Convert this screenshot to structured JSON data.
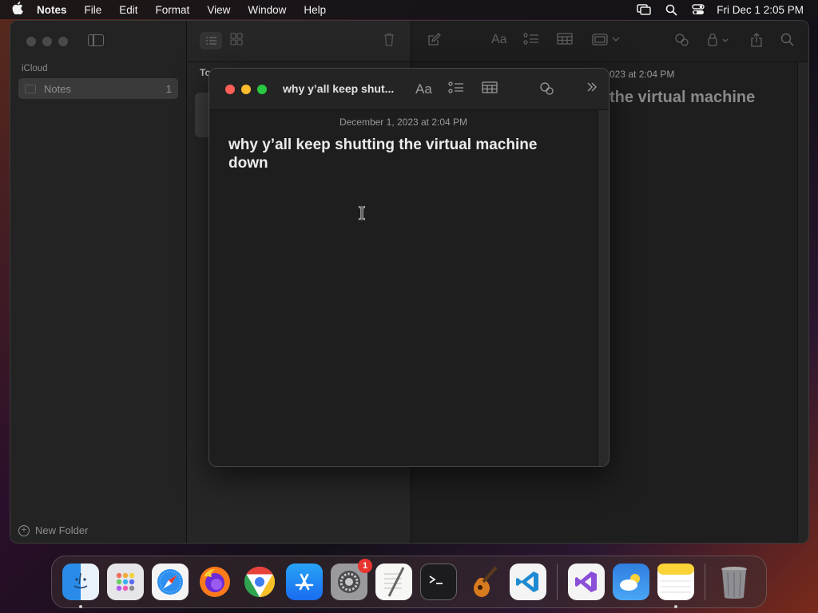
{
  "menubar": {
    "app_name": "Notes",
    "menus": [
      "File",
      "Edit",
      "Format",
      "View",
      "Window",
      "Help"
    ],
    "clock": "Fri Dec 1  2:05 PM"
  },
  "sidebar": {
    "section": "iCloud",
    "folder_name": "Notes",
    "folder_count": "1",
    "new_folder_label": "New Folder"
  },
  "list": {
    "group_header": "To"
  },
  "editor": {
    "date": "023 at 2:04 PM",
    "title": "the virtual machine"
  },
  "float_window": {
    "title": "why y’all keep shut...",
    "font_label": "Aa",
    "date": "December 1, 2023 at 2:04 PM",
    "note_title": "why y’all keep shutting the virtual machine down"
  },
  "dock": {
    "settings_badge": "1",
    "apps": [
      "finder-icon",
      "launchpad-icon",
      "safari-icon",
      "firefox-icon",
      "chrome-icon",
      "app-store-icon",
      "system-settings-icon",
      "textedit-icon",
      "terminal-icon",
      "garageband-icon",
      "vscode-icon",
      "visual-studio-icon",
      "weather-icon",
      "notes-icon",
      "trash-icon"
    ]
  }
}
